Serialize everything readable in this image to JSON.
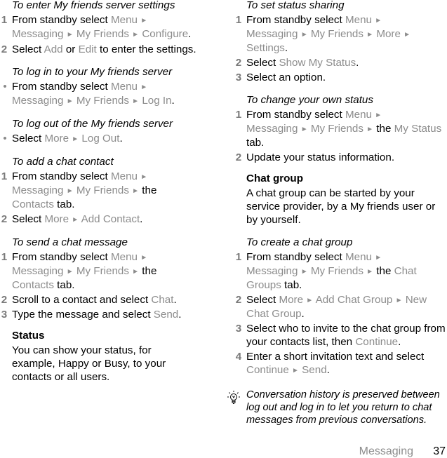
{
  "left": {
    "server_settings": {
      "heading": "To enter My friends server settings",
      "steps": [
        {
          "num": "1",
          "t1": "From standby select ",
          "m1": "Menu",
          "m2": "Messaging",
          "m3": "My Friends",
          "m4": "Configure",
          "end": "."
        },
        {
          "num": "2",
          "t1": "Select ",
          "m1": "Add",
          "t2": " or ",
          "m2": "Edit",
          "t3": " to enter the settings."
        }
      ]
    },
    "log_in": {
      "heading": "To log in to your My friends server",
      "t1": "From standby select ",
      "m1": "Menu",
      "m2": "Messaging",
      "m3": "My Friends",
      "m4": "Log In",
      "end": "."
    },
    "log_out": {
      "heading": "To log out of the My friends server",
      "t1": "Select ",
      "m1": "More",
      "m2": "Log Out",
      "end": "."
    },
    "add_contact": {
      "heading": "To add a chat contact",
      "steps": [
        {
          "num": "1",
          "t1": "From standby select ",
          "m1": "Menu",
          "m2": "Messaging",
          "m3": "My Friends",
          "t2": " the ",
          "m4": "Contacts",
          "t3": " tab."
        },
        {
          "num": "2",
          "t1": "Select ",
          "m1": "More",
          "m2": "Add Contact",
          "end": "."
        }
      ]
    },
    "send_message": {
      "heading": "To send a chat message",
      "steps": [
        {
          "num": "1",
          "t1": "From standby select ",
          "m1": "Menu",
          "m2": "Messaging",
          "m3": "My Friends",
          "t2": " the ",
          "m4": "Contacts",
          "t3": " tab."
        },
        {
          "num": "2",
          "t1": "Scroll to a contact and select ",
          "m1": "Chat",
          "end": "."
        },
        {
          "num": "3",
          "t1": "Type the message and select ",
          "m1": "Send",
          "end": "."
        }
      ]
    },
    "status": {
      "heading": "Status",
      "body": "You can show your status, for example, Happy or Busy, to your contacts or all users."
    }
  },
  "right": {
    "status_sharing": {
      "heading": "To set status sharing",
      "steps": [
        {
          "num": "1",
          "t1": "From standby select ",
          "m1": "Menu",
          "m2": "Messaging",
          "m3": "My Friends",
          "m4": "More",
          "m5": "Settings",
          "end": "."
        },
        {
          "num": "2",
          "t1": "Select ",
          "m1": "Show My Status",
          "end": "."
        },
        {
          "num": "3",
          "t1": "Select an option."
        }
      ]
    },
    "change_status": {
      "heading": "To change your own status",
      "steps": [
        {
          "num": "1",
          "t1": "From standby select ",
          "m1": "Menu",
          "m2": "Messaging",
          "m3": "My Friends",
          "t2": " the ",
          "m4": "My Status",
          "t3": " tab."
        },
        {
          "num": "2",
          "t1": "Update your status information."
        }
      ]
    },
    "chat_group": {
      "heading": "Chat group",
      "body": "A chat group can be started by your service provider, by a My friends user or by yourself."
    },
    "create_group": {
      "heading": "To create a chat group",
      "steps": [
        {
          "num": "1",
          "t1": "From standby select ",
          "m1": "Menu",
          "m2": "Messaging",
          "m3": "My Friends",
          "t2": " the ",
          "m4": "Chat Groups",
          "t3": " tab."
        },
        {
          "num": "2",
          "t1": "Select ",
          "m1": "More",
          "m2": "Add Chat Group",
          "m3": "New Chat Group",
          "end": "."
        },
        {
          "num": "3",
          "t1": "Select who to invite to the chat group from your contacts list, then ",
          "m1": "Continue",
          "end": "."
        },
        {
          "num": "4",
          "t1": "Enter a short invitation text and select ",
          "m1": "Continue",
          "m2": "Send",
          "end": "."
        }
      ]
    },
    "tip": {
      "icon": "lightbulb-icon",
      "text": "Conversation history is preserved between log out and log in to let you return to chat messages from previous conversations."
    }
  },
  "footer": {
    "section": "Messaging",
    "page": "37"
  },
  "glyphs": {
    "arrow": "►",
    "bullet": "•"
  },
  "colors": {
    "menu_text": "#8c8c8c",
    "step_number": "#7a7a7a"
  }
}
